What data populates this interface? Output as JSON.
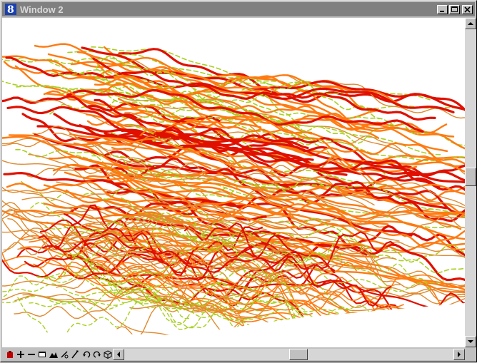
{
  "window": {
    "title": "Window 2"
  },
  "colors": {
    "titlebar": "#808080",
    "contour_index": "#e01000",
    "contour_major": "#ff7a10",
    "contour_minor": "#e08a30",
    "contour_dashed": "#a8d020"
  },
  "titlebar_controls": [
    {
      "name": "minimize-button",
      "icon": "minimize-icon"
    },
    {
      "name": "maximize-button",
      "icon": "maximize-icon"
    },
    {
      "name": "close-button",
      "icon": "close-icon"
    }
  ],
  "toolbar": {
    "tools": [
      {
        "name": "update-view-tool",
        "icon": "update-icon"
      },
      {
        "name": "zoom-in-tool",
        "icon": "plus-icon"
      },
      {
        "name": "zoom-out-tool",
        "icon": "minus-icon"
      },
      {
        "name": "window-area-tool",
        "icon": "window-area-icon"
      },
      {
        "name": "fit-view-tool",
        "icon": "fit-view-icon"
      },
      {
        "name": "rotate-view-tool",
        "icon": "rotate-icon"
      },
      {
        "name": "pan-view-tool",
        "icon": "pan-icon"
      },
      {
        "name": "view-previous-tool",
        "icon": "undo-icon"
      },
      {
        "name": "view-next-tool",
        "icon": "redo-icon"
      },
      {
        "name": "view-3d-tool",
        "icon": "cube-icon"
      }
    ]
  },
  "scrollbars": {
    "vertical_position": 0.48,
    "horizontal_position": 0.53
  }
}
